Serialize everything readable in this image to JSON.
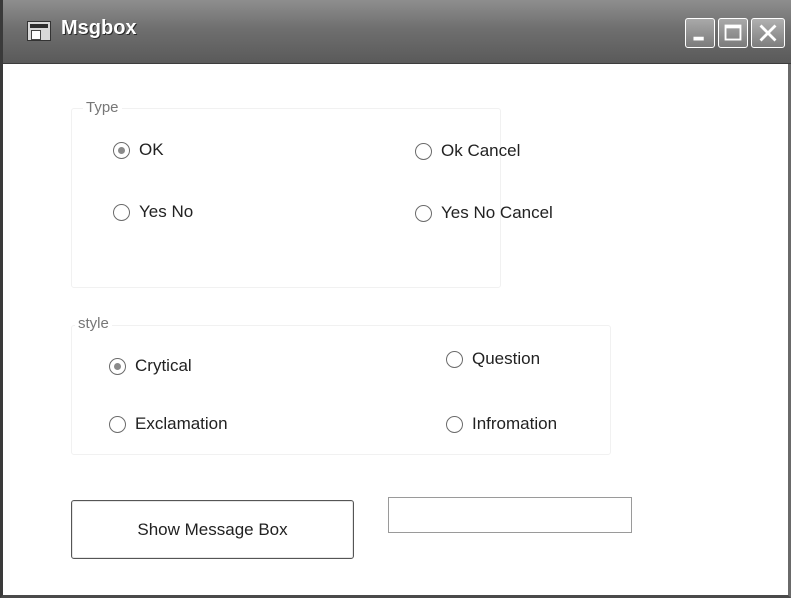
{
  "window": {
    "title": "Msgbox"
  },
  "type_group": {
    "label": "Type",
    "options": [
      {
        "label": "OK",
        "checked": true
      },
      {
        "label": "Ok Cancel",
        "checked": false
      },
      {
        "label": "Yes No",
        "checked": false
      },
      {
        "label": "Yes No Cancel",
        "checked": false
      }
    ]
  },
  "style_group": {
    "label": "style",
    "options": [
      {
        "label": "Crytical",
        "checked": true
      },
      {
        "label": "Question",
        "checked": false
      },
      {
        "label": "Exclamation",
        "checked": false
      },
      {
        "label": "Infromation",
        "checked": false
      }
    ]
  },
  "actions": {
    "show_button_label": "Show Message Box",
    "message_input_value": ""
  },
  "icons": {
    "app": "window-app-icon",
    "minimize": "minimize-icon",
    "maximize": "maximize-icon",
    "close": "close-icon"
  },
  "colors": {
    "titlebar": "#6f6f6f",
    "title_text": "#ffffff"
  }
}
